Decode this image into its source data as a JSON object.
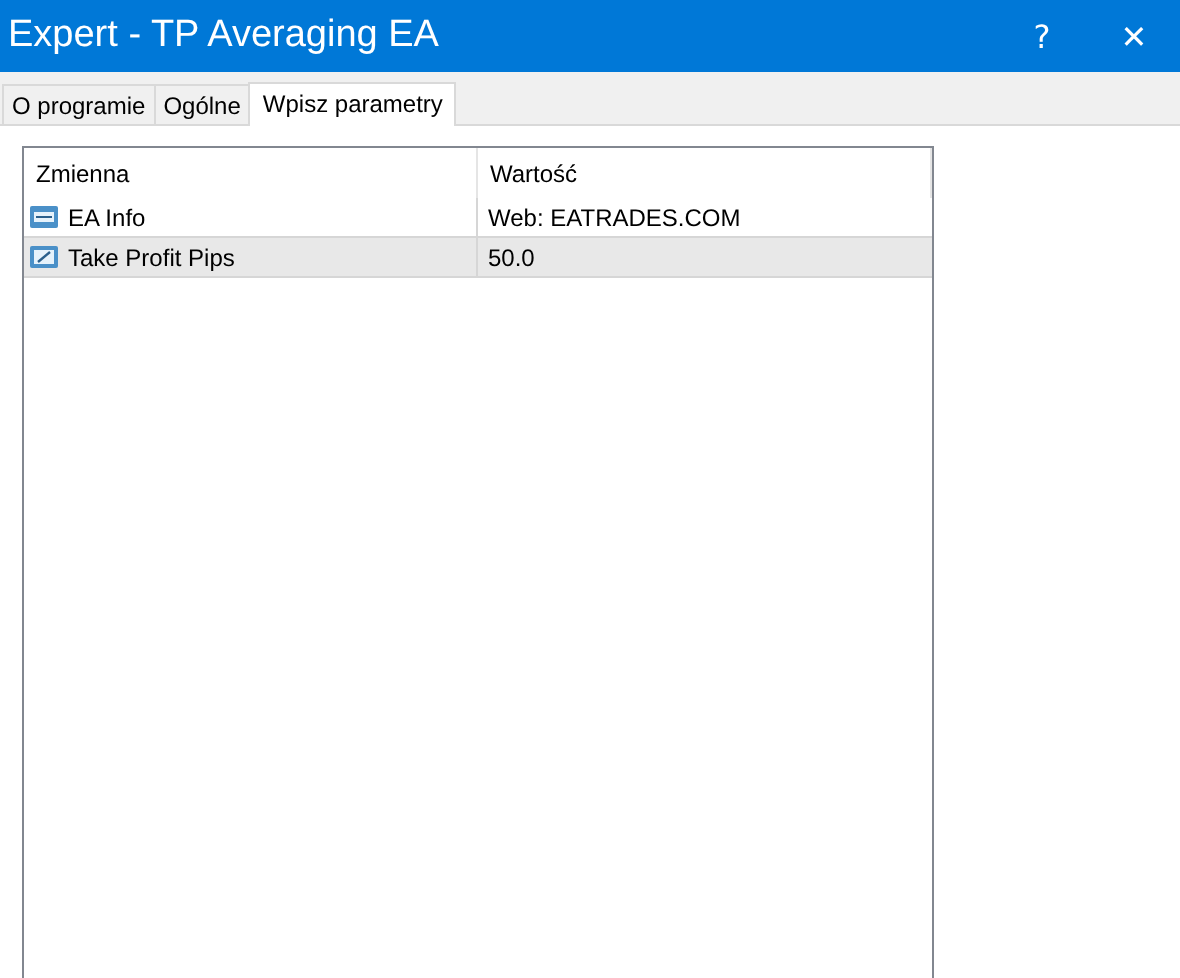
{
  "window": {
    "title": "Expert - TP Averaging EA",
    "buttons": [
      "?",
      "✕"
    ]
  },
  "tabs": [
    {
      "label": "O programie",
      "selected": false
    },
    {
      "label": "Ogólne",
      "selected": false
    },
    {
      "label": "Wpisz parametry",
      "selected": true
    }
  ],
  "table": {
    "columns": [
      "Zmienna",
      "Wartość"
    ],
    "rows": [
      {
        "kind": "integer",
        "name": "EA Info",
        "value": "Web: EATRADES.COM",
        "selected": false
      },
      {
        "kind": "double",
        "name": "Take Profit Pips",
        "value": "50.0",
        "selected": true
      }
    ]
  }
}
